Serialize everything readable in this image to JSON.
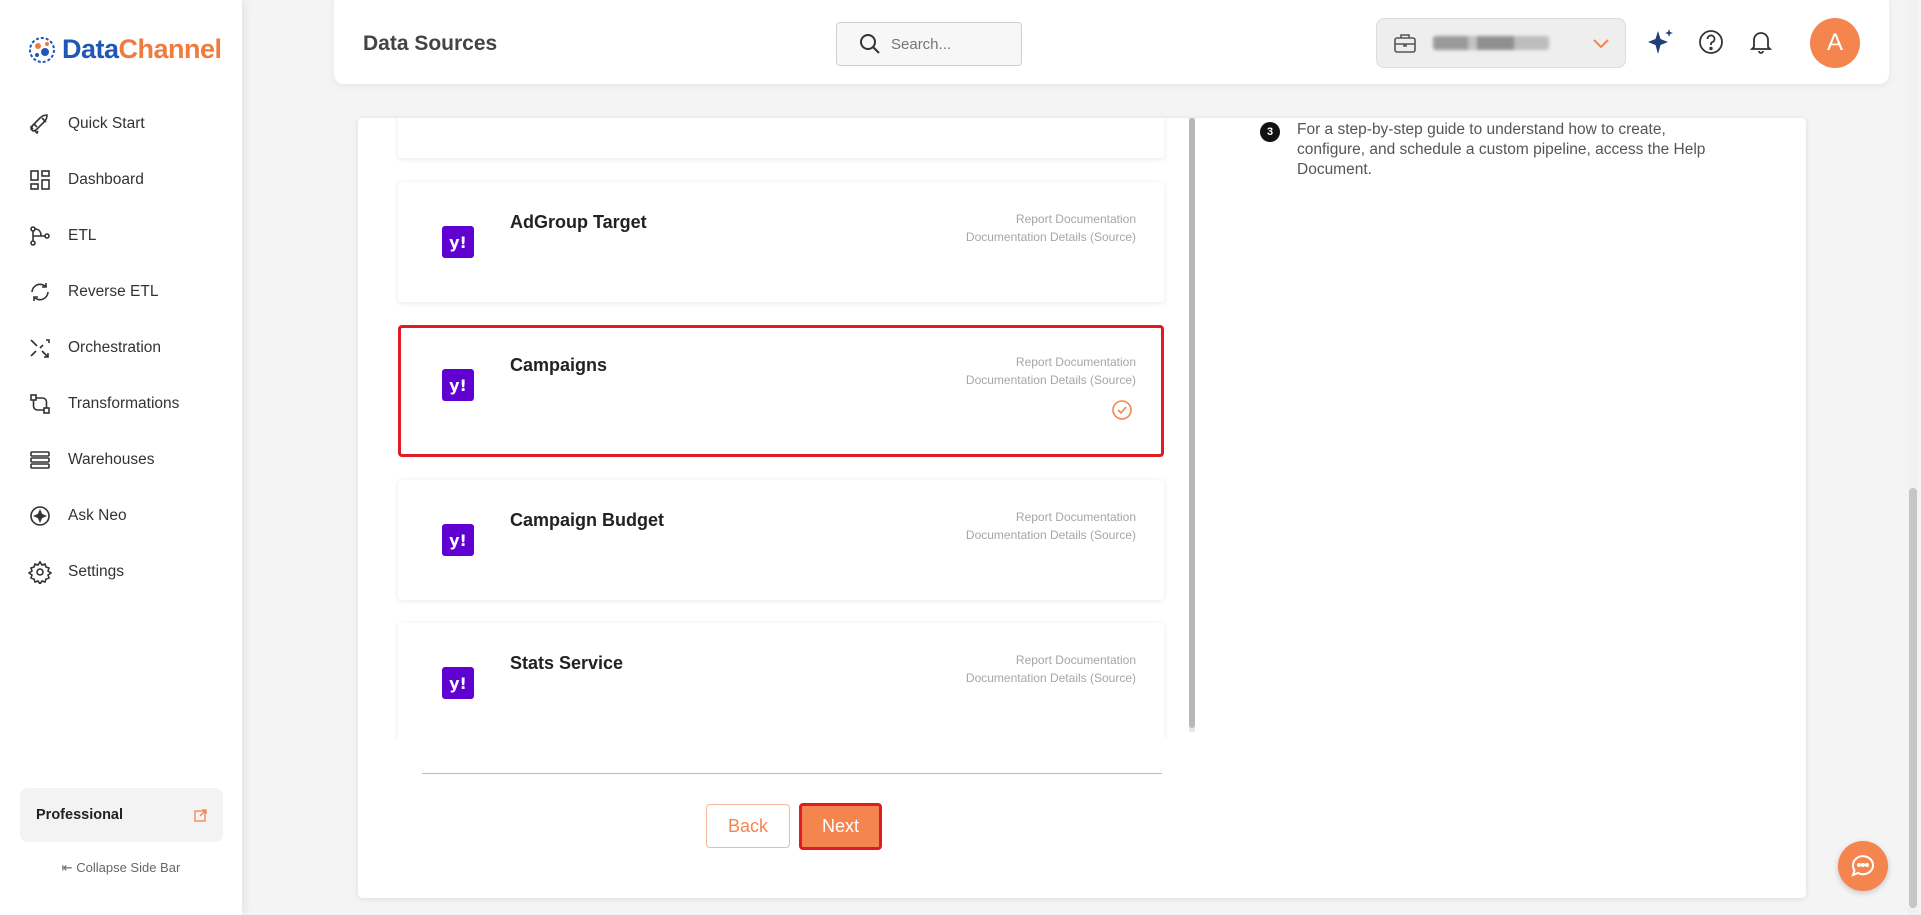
{
  "brand": {
    "part1": "Data",
    "part2": "Channel"
  },
  "sidebar": {
    "items": [
      {
        "label": "Quick Start",
        "icon": "rocket-icon"
      },
      {
        "label": "Dashboard",
        "icon": "dashboard-icon"
      },
      {
        "label": "ETL",
        "icon": "etl-icon"
      },
      {
        "label": "Reverse ETL",
        "icon": "reverse-etl-icon"
      },
      {
        "label": "Orchestration",
        "icon": "orchestration-icon"
      },
      {
        "label": "Transformations",
        "icon": "transformations-icon"
      },
      {
        "label": "Warehouses",
        "icon": "warehouses-icon"
      },
      {
        "label": "Ask Neo",
        "icon": "ask-neo-icon"
      },
      {
        "label": "Settings",
        "icon": "gear-icon"
      }
    ],
    "plan": "Professional",
    "collapse_label": "Collapse Side Bar"
  },
  "header": {
    "title": "Data Sources",
    "search_placeholder": "Search...",
    "avatar_initial": "A"
  },
  "reports": [
    {
      "name": "AdGroup Target",
      "doc1": "Report Documentation",
      "doc2": "Documentation Details (Source)",
      "selected": false
    },
    {
      "name": "Campaigns",
      "doc1": "Report Documentation",
      "doc2": "Documentation Details (Source)",
      "selected": true
    },
    {
      "name": "Campaign Budget",
      "doc1": "Report Documentation",
      "doc2": "Documentation Details (Source)",
      "selected": false
    },
    {
      "name": "Stats Service",
      "doc1": "Report Documentation",
      "doc2": "Documentation Details (Source)",
      "selected": false
    }
  ],
  "help": {
    "step": "3",
    "text": "For a step-by-step guide to understand how to create, configure, and schedule a custom pipeline, access the Help Document."
  },
  "actions": {
    "back_label": "Back",
    "next_label": "Next"
  },
  "colors": {
    "accent": "#f5854f",
    "selection": "#e11b22",
    "yahoo": "#6001d2",
    "brand_blue": "#1f57b8"
  }
}
